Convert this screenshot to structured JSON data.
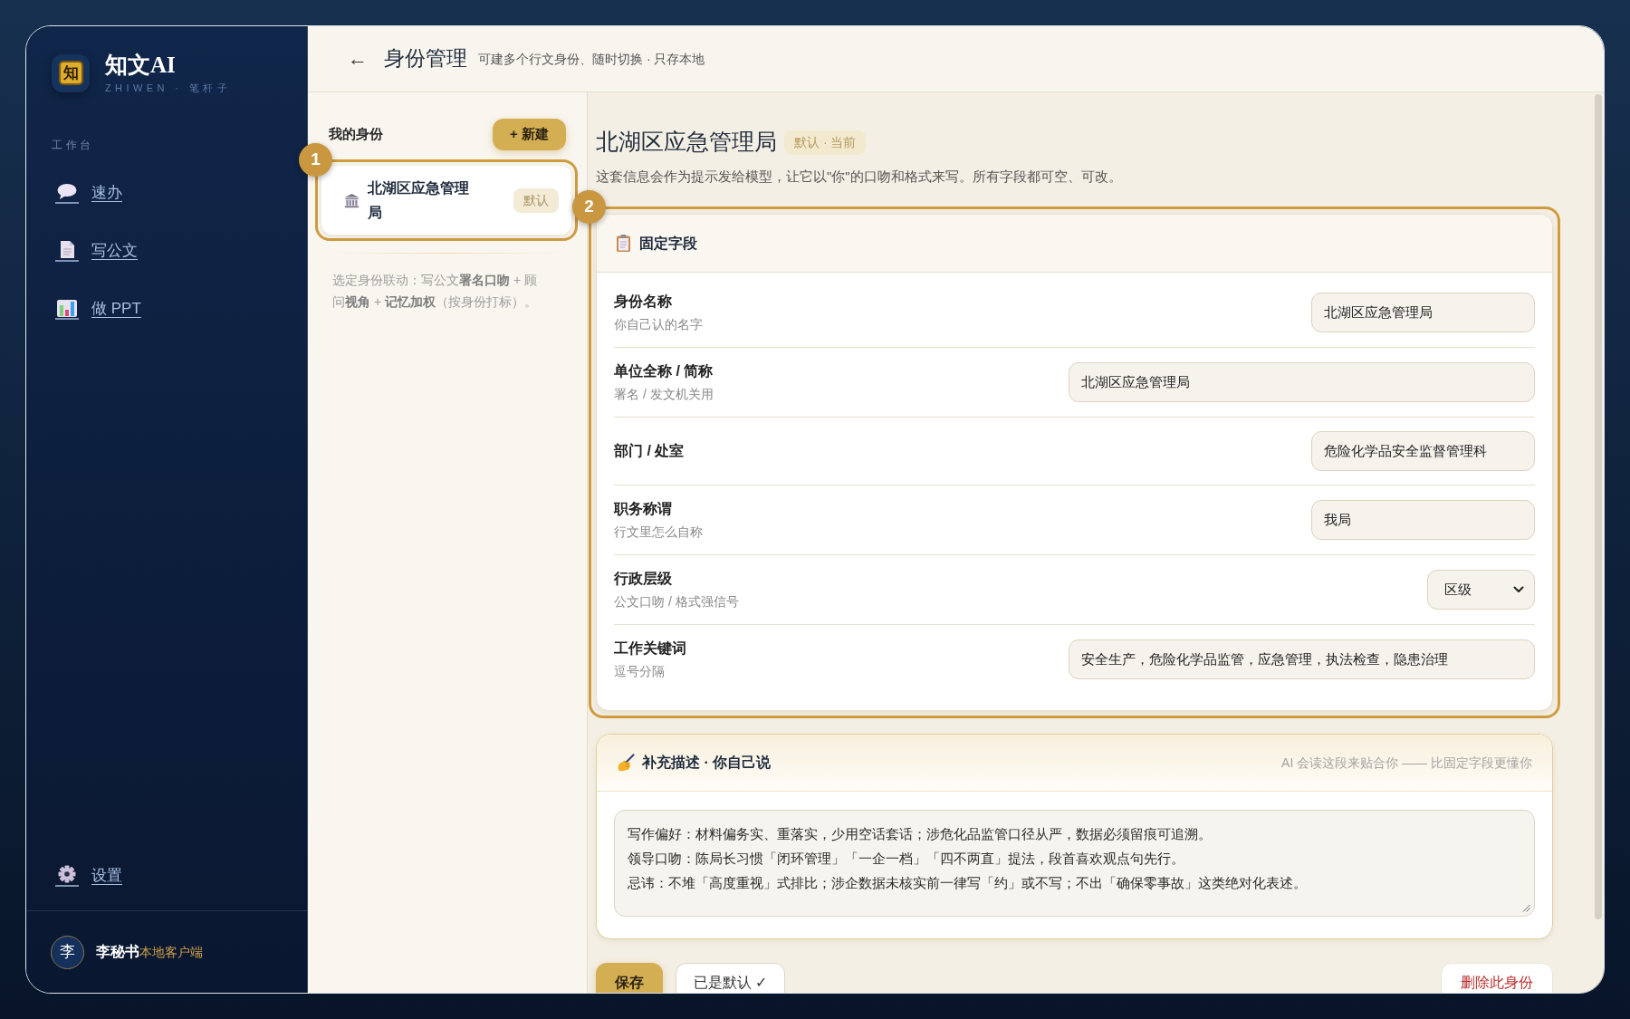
{
  "sidebar": {
    "logo": {
      "glyph": "知",
      "title": "知文AI",
      "subtitle": "ZHIWEN · 笔杆子"
    },
    "section_label": "工作台",
    "nav_items": [
      {
        "label": "速办"
      },
      {
        "label": "写公文"
      },
      {
        "label": "做 PPT"
      }
    ],
    "settings": {
      "label": "设置"
    },
    "user": {
      "avatar": "李",
      "name": "李秘书",
      "tag": "本地客户端"
    }
  },
  "header": {
    "back": "←",
    "title": "身份管理",
    "subtitle": "可建多个行文身份、随时切换 · 只存本地"
  },
  "identity_list": {
    "title": "我的身份",
    "new_button": "+ 新建",
    "callout": "1",
    "items": [
      {
        "name": "北湖区应急管理局",
        "badge": "默认",
        "selected": true
      }
    ],
    "hint": "选定身份联动：写公文**署名口吻** + 顾问**视角** + **记忆加权**（按身份打标）。"
  },
  "detail": {
    "title": "北湖区应急管理局",
    "badge": "默认 · 当前",
    "description": "这套信息会作为提示发给模型，让它以\"你\"的口吻和格式来写。所有字段都可空、可改。",
    "fixed_fields": {
      "callout": "2",
      "title": "固定字段",
      "fields": [
        {
          "label": "身份名称",
          "hint": "你自己认的名字",
          "kind": "short",
          "value": "北湖区应急管理局"
        },
        {
          "label": "单位全称 / 简称",
          "hint": "署名 / 发文机关用",
          "kind": "long",
          "value": "北湖区应急管理局"
        },
        {
          "label": "部门 / 处室",
          "kind": "short",
          "value": "危险化学品安全监督管理科"
        },
        {
          "label": "职务称谓",
          "hint": "行文里怎么自称",
          "kind": "short",
          "value": "我局"
        },
        {
          "label": "行政层级",
          "hint": "公文口吻 / 格式强信号",
          "kind": "select",
          "value": "区级"
        },
        {
          "label": "工作关键词",
          "hint": "逗号分隔",
          "kind": "long",
          "value": "安全生产，危险化学品监管，应急管理，执法检查，隐患治理"
        }
      ]
    },
    "supplement": {
      "title": "补充描述 · 你自己说",
      "note": "AI 会读这段来贴合你 —— 比固定字段更懂你",
      "lines": [
        "写作偏好：材料偏务实、重落实，少用空话套话；涉危化品监管口径从严，数据必须留痕可追溯。",
        "领导口吻：陈局长习惯「闭环管理」「一企一档」「四不两直」提法，段首喜欢观点句先行。",
        "忌讳：不堆「高度重视」式排比；涉企数据未核实前一律写「约」或不写；不出「确保零事故」这类绝对化表述。"
      ]
    },
    "actions": {
      "save": "保存",
      "set_default": "已是默认 ✓",
      "delete": "删除此身份"
    }
  }
}
